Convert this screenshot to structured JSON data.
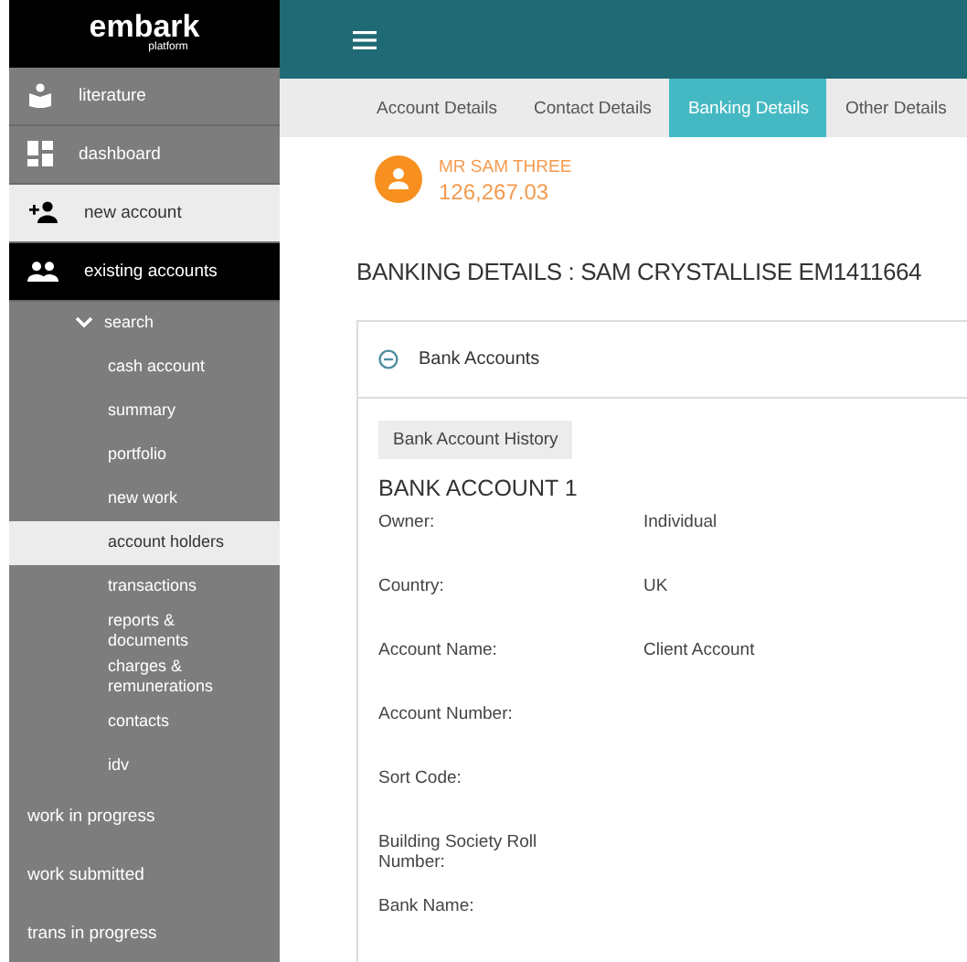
{
  "logo": {
    "name": "embark",
    "tagline": "platform"
  },
  "sidebar": {
    "items": [
      {
        "label": "literature",
        "selected": false,
        "expanded": false
      },
      {
        "label": "dashboard",
        "selected": false,
        "expanded": false
      },
      {
        "label": "new account",
        "selected": true,
        "expanded": false
      },
      {
        "label": "existing accounts",
        "selected": false,
        "expanded": true,
        "children": [
          {
            "label": "search",
            "selected": false,
            "expanded": true,
            "children": [
              {
                "label": "cash account",
                "selected": false
              },
              {
                "label": "summary",
                "selected": false
              },
              {
                "label": "portfolio",
                "selected": false
              },
              {
                "label": "new work",
                "selected": false
              },
              {
                "label": "account holders",
                "selected": true
              },
              {
                "label": "transactions",
                "selected": false
              },
              {
                "label": "reports & documents",
                "selected": false
              },
              {
                "label": "charges & remunerations",
                "selected": false
              },
              {
                "label": "contacts",
                "selected": false
              },
              {
                "label": "idv",
                "selected": false
              }
            ]
          }
        ]
      },
      {
        "label": "work in progress",
        "selected": false,
        "expanded": false
      },
      {
        "label": "work submitted",
        "selected": false,
        "expanded": false
      },
      {
        "label": "trans in progress",
        "selected": false,
        "expanded": false
      }
    ]
  },
  "tabs": [
    {
      "label": "Account Details",
      "selected": false
    },
    {
      "label": "Contact Details",
      "selected": false
    },
    {
      "label": "Banking Details",
      "selected": true
    },
    {
      "label": "Other Details",
      "selected": false
    }
  ],
  "client": {
    "name": "MR SAM THREE",
    "value": "126,267.03"
  },
  "heading": "BANKING DETAILS : SAM CRYSTALLISE EM1411664",
  "panel": {
    "title": "Bank Accounts",
    "expanded": true,
    "history_button": "Bank Account History",
    "account_title": "BANK ACCOUNT 1",
    "fields": [
      {
        "label": "Owner:",
        "value": "Individual"
      },
      {
        "label": "Country:",
        "value": "UK"
      },
      {
        "label": "Account Name:",
        "value": "Client Account"
      },
      {
        "label": "Account Number:"
      },
      {
        "label": "Sort Code:"
      },
      {
        "label": "Building Society Roll Number:"
      },
      {
        "label": "Bank Name:"
      }
    ]
  }
}
